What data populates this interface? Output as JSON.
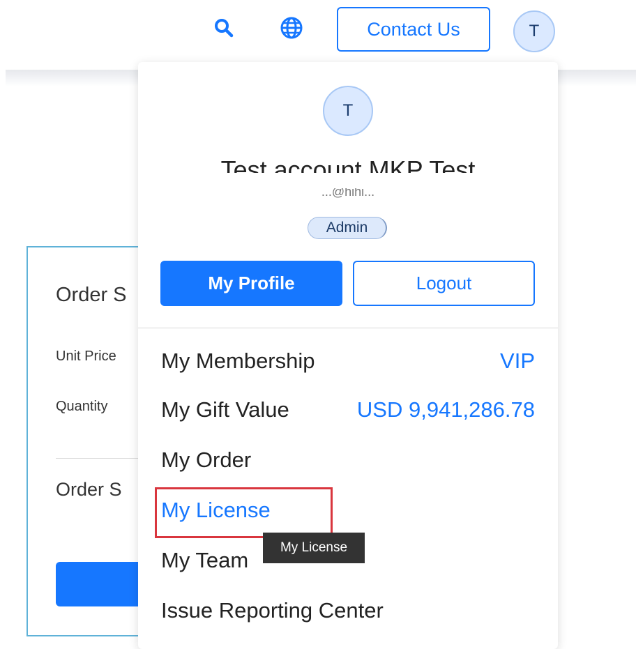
{
  "header": {
    "search_icon": "search-icon",
    "globe_icon": "globe-icon",
    "contact_label": "Contact Us",
    "avatar_initial": "T"
  },
  "background_card": {
    "title": "Order S",
    "unit_price_label": "Unit Price",
    "quantity_label": "Quantity",
    "summary_label": "Order S"
  },
  "dropdown": {
    "avatar_initial": "T",
    "user_name": "Test account MKP Test",
    "user_email": "...@hihi...",
    "role_badge": "Admin",
    "my_profile_label": "My Profile",
    "logout_label": "Logout",
    "menu": {
      "membership_label": "My Membership",
      "membership_value": "VIP",
      "gift_label": "My Gift Value",
      "gift_value": "USD 9,941,286.78",
      "order_label": "My Order",
      "license_label": "My License",
      "team_label": "My Team",
      "issue_label": "Issue Reporting Center"
    },
    "tooltip": "My License"
  },
  "colors": {
    "accent": "#1677ff",
    "highlight": "#d9363e",
    "tooltip_bg": "#333333"
  }
}
